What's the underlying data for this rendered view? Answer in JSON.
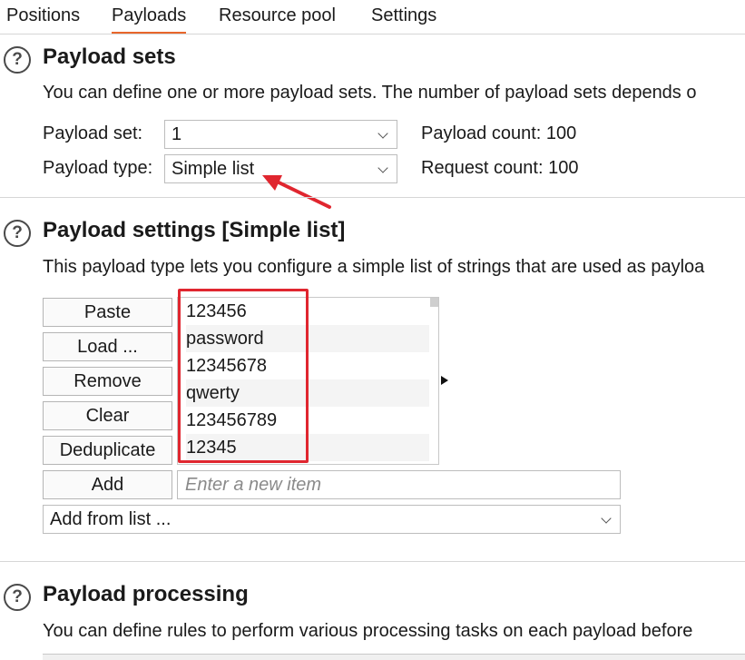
{
  "tabs": [
    {
      "label": "Positions",
      "active": false
    },
    {
      "label": "Payloads",
      "active": true
    },
    {
      "label": "Resource pool",
      "active": false
    },
    {
      "label": "Settings",
      "active": false
    }
  ],
  "payload_sets": {
    "title": "Payload sets",
    "description": "You can define one or more payload sets. The number of payload sets depends o",
    "set_label": "Payload set:",
    "set_value": "1",
    "type_label": "Payload type:",
    "type_value": "Simple list",
    "payload_count": "Payload count: 100",
    "request_count": "Request count: 100"
  },
  "payload_settings": {
    "title": "Payload settings [Simple list]",
    "description": "This payload type lets you configure a simple list of strings that are used as payloa",
    "buttons": {
      "paste": "Paste",
      "load": "Load ...",
      "remove": "Remove",
      "clear": "Clear",
      "deduplicate": "Deduplicate",
      "add": "Add"
    },
    "items": [
      "123456",
      "password",
      "12345678",
      "qwerty",
      "123456789",
      "12345"
    ],
    "new_item_placeholder": "Enter a new item",
    "add_from_list": "Add from list ..."
  },
  "payload_processing": {
    "title": "Payload processing",
    "description": "You can define rules to perform various processing tasks on each payload before"
  },
  "colors": {
    "active_tab_underline": "#e8662b",
    "annotation_red": "#e0262f"
  }
}
